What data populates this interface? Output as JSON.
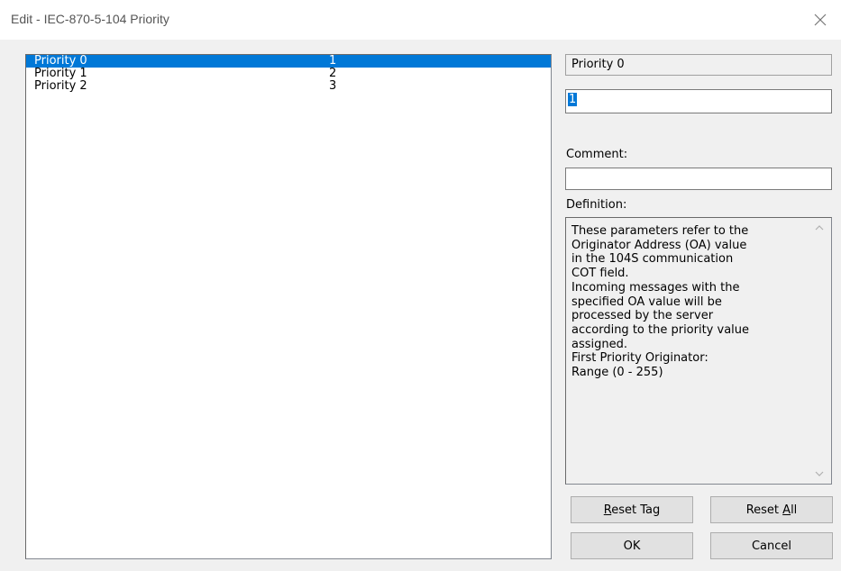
{
  "window": {
    "title": "Edit - IEC-870-5-104 Priority"
  },
  "list": {
    "items": [
      {
        "name": "Priority 0",
        "value": "1"
      },
      {
        "name": "Priority 1",
        "value": "2"
      },
      {
        "name": "Priority 2",
        "value": "3"
      }
    ],
    "selected_index": 0
  },
  "editor": {
    "parameter_name": "Priority 0",
    "value": "1",
    "comment_label": "Comment:",
    "comment_value": "",
    "definition_label": "Definition:",
    "definition_text": "These parameters refer to the\nOriginator Address (OA) value\nin the 104S communication\nCOT field.\nIncoming messages with the\nspecified OA value will be\nprocessed by the server\naccording to the priority value\nassigned.\nFirst Priority Originator:\nRange (0 - 255)"
  },
  "buttons": {
    "reset_tag": {
      "before": "",
      "mnemonic": "R",
      "after": "eset Tag"
    },
    "reset_all": {
      "before": "Reset ",
      "mnemonic": "A",
      "after": "ll"
    },
    "ok": "OK",
    "cancel": "Cancel"
  },
  "icons": {
    "close": "close-icon",
    "scroll_up": "scroll-up-arrow-icon",
    "scroll_down": "scroll-down-arrow-icon"
  },
  "colors": {
    "selection": "#0078d7",
    "dialog_background": "#f0f0f0",
    "button_face": "#e1e1e1"
  }
}
